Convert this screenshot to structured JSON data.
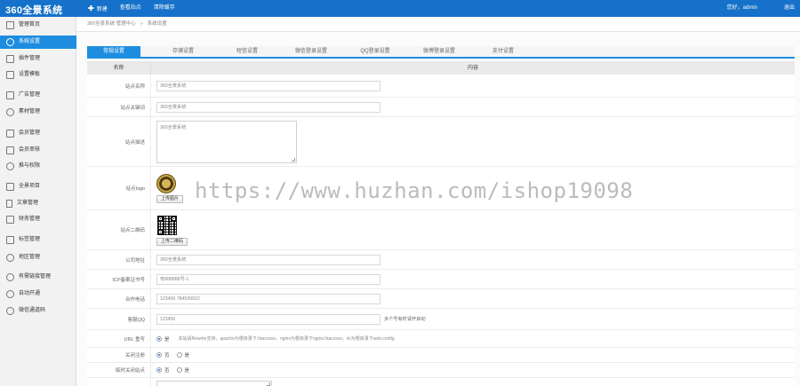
{
  "app": {
    "logo": "360全景系统"
  },
  "topnav": [
    {
      "label": "新建",
      "icon": "plus-icon"
    },
    {
      "label": "查看站点"
    },
    {
      "label": "清除缓存"
    }
  ],
  "user": {
    "greeting": "您好，admin",
    "logout": "退出"
  },
  "sidebar": {
    "items": [
      {
        "label": "管理首页",
        "icon": "home-icon"
      },
      {
        "label": "系统设置",
        "icon": "gear-icon",
        "active": true
      },
      {
        "label": "插件管理",
        "icon": "plugin-icon"
      },
      {
        "label": "设置模板",
        "icon": "template-icon"
      },
      {
        "label": "广告管理",
        "icon": "ad-icon"
      },
      {
        "label": "素材管理",
        "icon": "link-icon"
      },
      {
        "label": "会员管理",
        "icon": "user-icon"
      },
      {
        "label": "会员审核",
        "icon": "audit-icon"
      },
      {
        "label": "推与权限",
        "icon": "share-icon"
      },
      {
        "label": "全景项目",
        "icon": "grid-icon"
      },
      {
        "label": "文章管理",
        "icon": "doc-icon"
      },
      {
        "label": "财务管理",
        "icon": "finance-icon"
      },
      {
        "label": "标签管理",
        "icon": "tag-icon"
      },
      {
        "label": "地区管理",
        "icon": "globe-icon"
      },
      {
        "label": "有需链接管理",
        "icon": "link2-icon"
      },
      {
        "label": "自动开通",
        "icon": "auto-icon"
      },
      {
        "label": "微信通道码",
        "icon": "wechat-icon"
      }
    ]
  },
  "breadcrumb": {
    "root": "360全景系统 管理中心",
    "current": "系统设置"
  },
  "tabs": [
    "常规设置",
    "存储设置",
    "短信设置",
    "微信登录设置",
    "QQ登录设置",
    "微博登录设置",
    "支付设置"
  ],
  "table": {
    "col_name": "名称",
    "col_content": "内容"
  },
  "form": {
    "site_name": {
      "label": "站点名称",
      "value": "360全景系统"
    },
    "site_keywords": {
      "label": "站点关键词",
      "value": "360全景系统"
    },
    "site_desc": {
      "label": "站点描述",
      "value": "360全景系统"
    },
    "site_logo": {
      "label": "站点logo",
      "button": "上传图片"
    },
    "site_qrcode": {
      "label": "站点二维码",
      "button": "上传二维码"
    },
    "company_addr": {
      "label": "公司地址",
      "value": "360全景系统"
    },
    "icp": {
      "label": "ICP备案证书号",
      "value": "粤888888号-1"
    },
    "phone": {
      "label": "合作电话",
      "value": "123456  784539922"
    },
    "qq": {
      "label": "客服QQ",
      "value": "123456",
      "suffix": "多个号有时请开启动"
    },
    "url_rewrite": {
      "label": "URL 重写",
      "options": [
        "是"
      ],
      "hint": "本站请Rewrite支持，apache为根目录下.htaccess，nginx为根目录下nginx.htaccess，iis为根目录下web.config"
    },
    "close_reg": {
      "label": "关闭注册",
      "options": [
        "否",
        "是"
      ]
    },
    "close_site": {
      "label": "临时关闭站点",
      "options": [
        "否",
        "是"
      ]
    }
  },
  "watermark": "https://www.huzhan.com/ishop19098"
}
